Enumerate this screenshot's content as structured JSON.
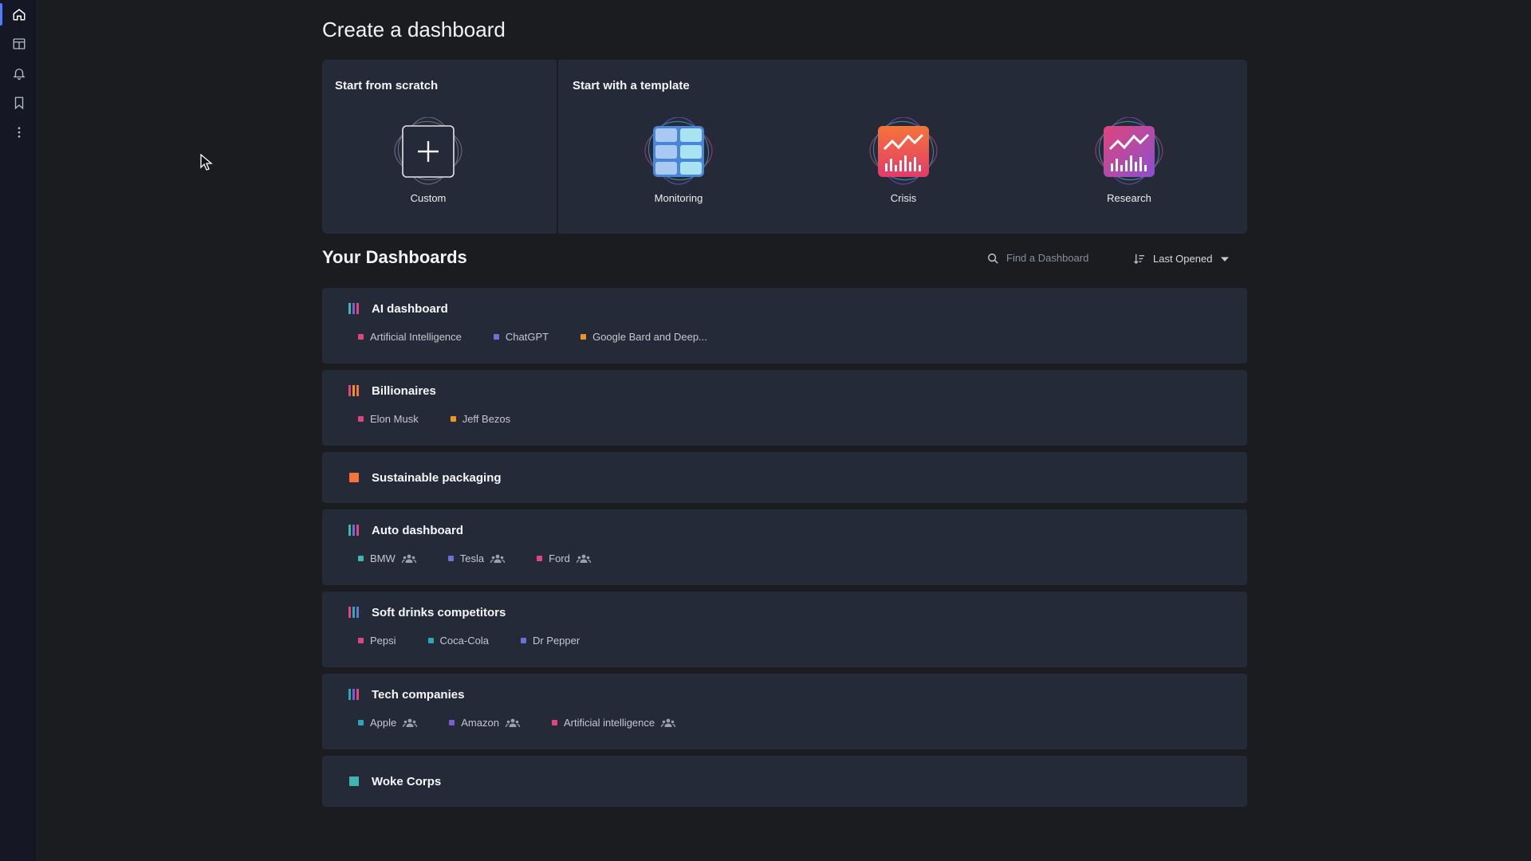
{
  "sidebar": {
    "items": [
      {
        "name": "home",
        "icon": "home-icon"
      },
      {
        "name": "layout",
        "icon": "layout-icon"
      },
      {
        "name": "alerts",
        "icon": "bell-icon"
      },
      {
        "name": "saved",
        "icon": "bookmark-icon"
      },
      {
        "name": "more",
        "icon": "more-vertical-icon"
      }
    ]
  },
  "create": {
    "title": "Create a dashboard",
    "scratch_label": "Start from scratch",
    "template_label": "Start with a template",
    "custom_label": "Custom",
    "templates": [
      {
        "label": "Monitoring"
      },
      {
        "label": "Crisis"
      },
      {
        "label": "Research"
      }
    ]
  },
  "dashboards": {
    "title": "Your Dashboards",
    "search_placeholder": "Find a Dashboard",
    "sort_label": "Last Opened",
    "items": [
      {
        "title": "AI dashboard",
        "tags": [
          {
            "label": "Artificial Intelligence",
            "color": "#e0457b"
          },
          {
            "label": "ChatGPT",
            "color": "#6a72d8"
          },
          {
            "label": "Google Bard and Deep...",
            "color": "#f0941f"
          }
        ]
      },
      {
        "title": "Billionaires",
        "tags": [
          {
            "label": "Elon Musk",
            "color": "#e0457b"
          },
          {
            "label": "Jeff Bezos",
            "color": "#f0941f"
          }
        ]
      },
      {
        "title": "Sustainable packaging",
        "tags": []
      },
      {
        "title": "Auto dashboard",
        "tags": [
          {
            "label": "BMW",
            "color": "#3fb6b0"
          },
          {
            "label": "Tesla",
            "color": "#6a72d8"
          },
          {
            "label": "Ford",
            "color": "#e0457b"
          }
        ]
      },
      {
        "title": "Soft drinks competitors",
        "tags": [
          {
            "label": "Pepsi",
            "color": "#e0457b"
          },
          {
            "label": "Coca-Cola",
            "color": "#2aa8b6"
          },
          {
            "label": "Dr Pepper",
            "color": "#6a72d8"
          }
        ]
      },
      {
        "title": "Tech companies",
        "tags": [
          {
            "label": "Apple",
            "color": "#2aa8b6"
          },
          {
            "label": "Amazon",
            "color": "#7a5fd0"
          },
          {
            "label": "Artificial intelligence",
            "color": "#e0457b"
          }
        ]
      },
      {
        "title": "Woke Corps",
        "tags": []
      }
    ]
  },
  "colors": {
    "background": "#1b1c20",
    "card": "#252a38",
    "accent": "#4f7cff"
  }
}
